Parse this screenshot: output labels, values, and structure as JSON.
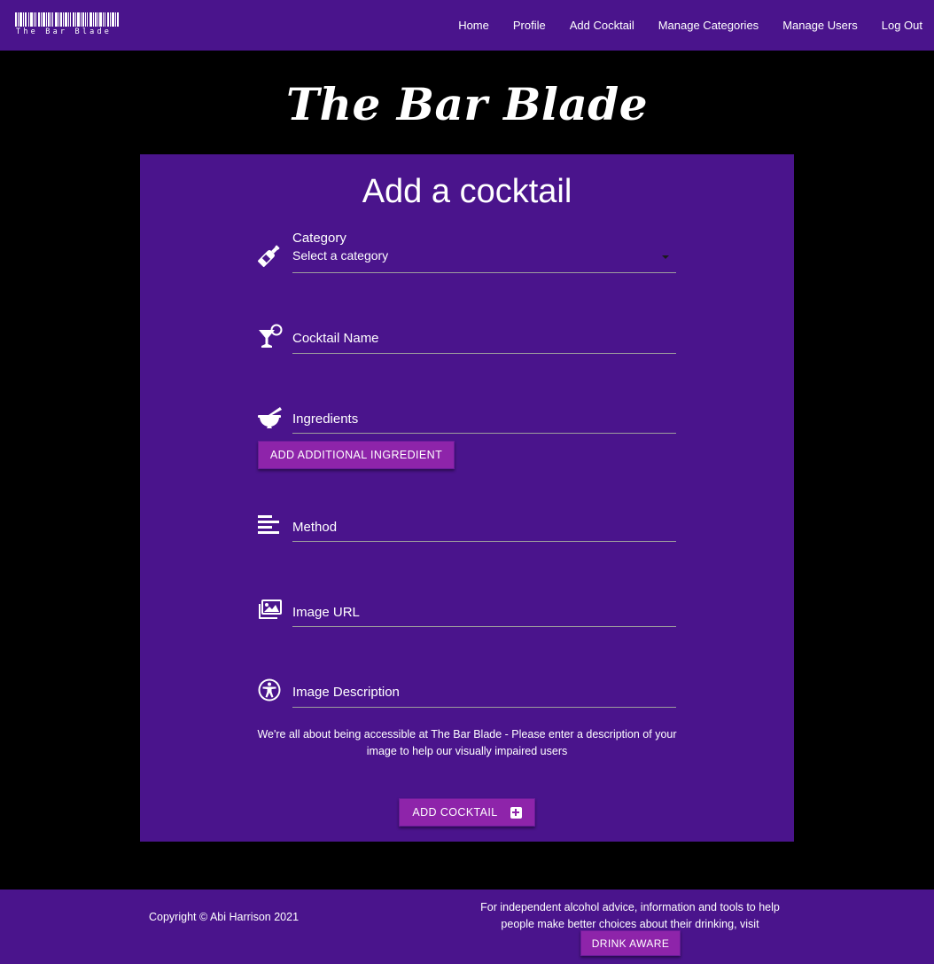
{
  "nav": {
    "logo_text": "The Bar Blade",
    "links": [
      "Home",
      "Profile",
      "Add Cocktail",
      "Manage Categories",
      "Manage Users",
      "Log Out"
    ]
  },
  "site_title": "The Bar Blade",
  "form": {
    "title": "Add a cocktail",
    "category_label": "Category",
    "category_value": "Select a category",
    "cocktail_name_label": "Cocktail Name",
    "ingredients_label": "Ingredients",
    "add_ingredient_button": "ADD ADDITIONAL INGREDIENT",
    "method_label": "Method",
    "image_url_label": "Image URL",
    "image_description_label": "Image Description",
    "helper_text": "We're all about being accessible at The Bar Blade - Please enter a description of your image to help our visually impaired users",
    "submit_button": "ADD COCKTAIL"
  },
  "footer": {
    "copyright": "Copyright © Abi Harrison 2021",
    "drink_aware_text": "For independent alcohol advice, information and tools to help people make better choices about their drinking, visit",
    "drink_aware_button": "DRINK AWARE"
  },
  "colors": {
    "primary": "#4a148c",
    "button": "#8e24aa",
    "background": "#000000"
  },
  "icons": {
    "category": "wine-bottle-icon",
    "cocktail_name": "cocktail-glass-icon",
    "ingredients": "mortar-pestle-icon",
    "method": "align-left-icon",
    "image_url": "images-icon",
    "image_description": "universal-access-icon",
    "submit": "plus-square-icon"
  }
}
